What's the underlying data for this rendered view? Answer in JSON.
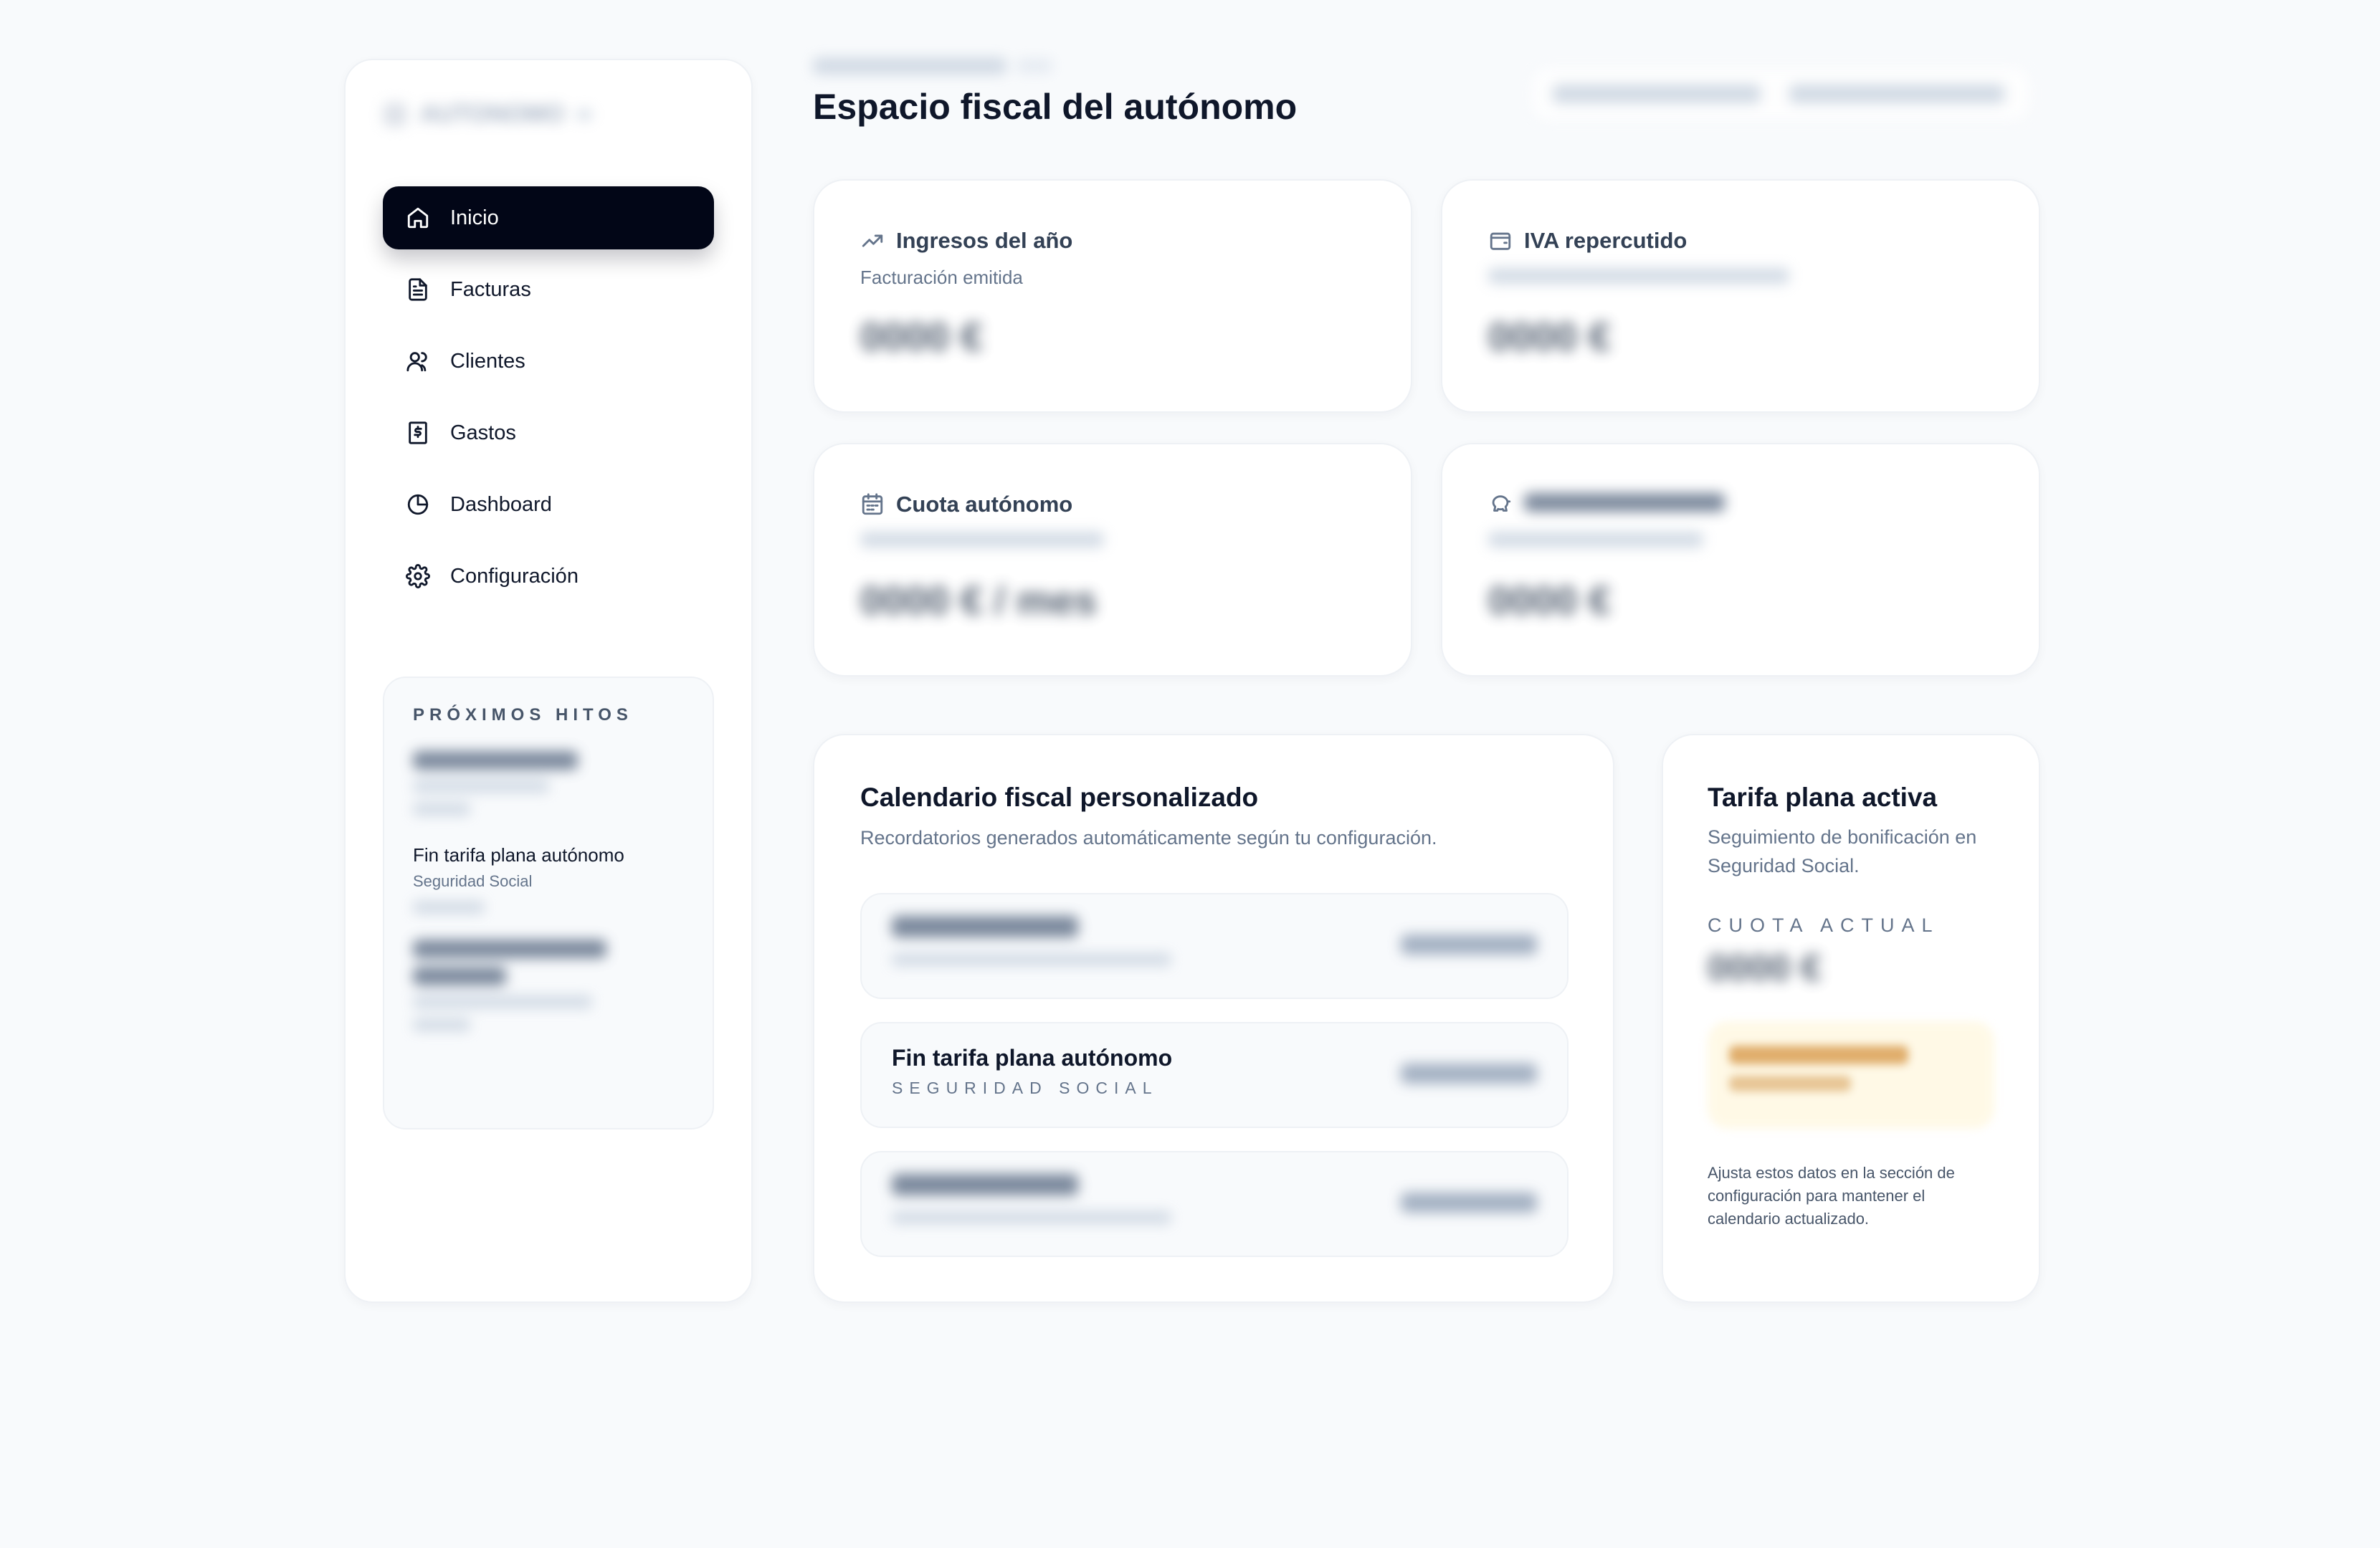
{
  "sidebar": {
    "brand": {
      "name": "AUTONOMO"
    },
    "items": [
      {
        "label": "Inicio",
        "icon": "home-icon",
        "active": true
      },
      {
        "label": "Facturas",
        "icon": "file-text-icon",
        "active": false
      },
      {
        "label": "Clientes",
        "icon": "users-icon",
        "active": false
      },
      {
        "label": "Gastos",
        "icon": "receipt-icon",
        "active": false
      },
      {
        "label": "Dashboard",
        "icon": "pie-chart-icon",
        "active": false
      },
      {
        "label": "Configuración",
        "icon": "gear-icon",
        "active": false
      }
    ],
    "milestones": {
      "title": "PRÓXIMOS HITOS",
      "featured": {
        "title": "Fin tarifa plana autónomo",
        "category": "Seguridad Social"
      }
    }
  },
  "header": {
    "title": "Espacio fiscal del autónomo"
  },
  "stats": [
    {
      "label": "Ingresos del año",
      "sub": "Facturación emitida",
      "value": "0000 €",
      "icon": "trending-up-icon"
    },
    {
      "label": "IVA repercutido",
      "sub": "",
      "value": "0000 €",
      "icon": "wallet-icon"
    },
    {
      "label": "Cuota autónomo",
      "sub": "",
      "value": "0000 € / mes",
      "icon": "calendar-icon"
    },
    {
      "label": "",
      "sub": "",
      "value": "0000 €",
      "icon": "piggy-bank-icon"
    }
  ],
  "calendar": {
    "title": "Calendario fiscal personalizado",
    "subtitle": "Recordatorios generados automáticamente según tu configuración.",
    "featured_row": {
      "title": "Fin tarifa plana autónomo",
      "category": "SEGURIDAD SOCIAL"
    }
  },
  "tarifa": {
    "title": "Tarifa plana activa",
    "subtitle": "Seguimiento de bonificación en Seguridad Social.",
    "label": "CUOTA ACTUAL",
    "value": "0000 €",
    "note": "Ajusta estos datos en la sección de configuración para mantener el calendario actualizado."
  },
  "colors": {
    "background": "#f8fafc",
    "active_nav": "#020617",
    "text_primary": "#0f172a",
    "text_muted": "#64748b",
    "alert_bg": "#fff8e1"
  }
}
